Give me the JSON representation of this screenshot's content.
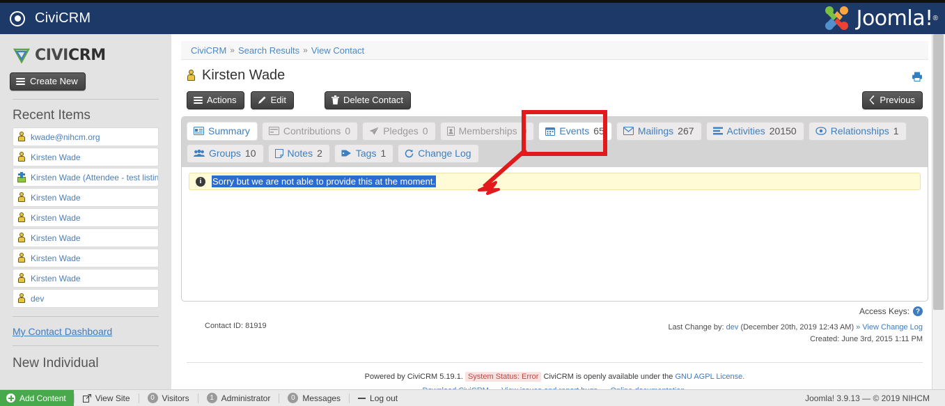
{
  "topbar": {
    "app_name": "CiviCRM",
    "logo_icon": "bullseye-icon",
    "brand_logo": "joomla-logo",
    "brand_name": "Joomla!",
    "brand_registered": "®"
  },
  "sidebar": {
    "logo_text_a": "CIVI",
    "logo_text_b": "CRM",
    "create_new_label": "Create New",
    "recent_items_title": "Recent Items",
    "recent_items": [
      {
        "label": "kwade@nihcm.org",
        "icon": "contact-icon"
      },
      {
        "label": "Kirsten Wade",
        "icon": "contact-icon"
      },
      {
        "label": "Kirsten Wade (Attendee - test listing)",
        "icon": "event-participant-icon"
      },
      {
        "label": "Kirsten Wade",
        "icon": "contact-icon"
      },
      {
        "label": "Kirsten Wade",
        "icon": "contact-icon"
      },
      {
        "label": "Kirsten Wade",
        "icon": "contact-icon"
      },
      {
        "label": "Kirsten Wade",
        "icon": "contact-icon"
      },
      {
        "label": "Kirsten Wade",
        "icon": "contact-icon"
      },
      {
        "label": "dev",
        "icon": "contact-icon"
      }
    ],
    "dashboard_link": "My Contact Dashboard",
    "new_individual_heading": "New Individual"
  },
  "breadcrumb": {
    "items": [
      "CiviCRM",
      "Search Results",
      "View Contact"
    ],
    "separator": "»"
  },
  "contact": {
    "name": "Kirsten Wade",
    "icon": "contact-lock-icon",
    "print_icon": "printer-icon"
  },
  "actions": {
    "actions_label": "Actions",
    "edit_label": "Edit",
    "delete_label": "Delete Contact",
    "previous_label": "Previous",
    "actions_icon": "hamburger-icon",
    "edit_icon": "pencil-icon",
    "delete_icon": "trash-icon",
    "previous_icon": "chevron-left-icon"
  },
  "tabs": [
    {
      "label": "Summary",
      "count": "",
      "icon": "id-card-icon",
      "state": "active"
    },
    {
      "label": "Contributions",
      "count": "0",
      "icon": "credit-card-icon",
      "state": "disabled"
    },
    {
      "label": "Pledges",
      "count": "0",
      "icon": "paper-plane-icon",
      "state": "disabled"
    },
    {
      "label": "Memberships",
      "count": "0",
      "icon": "id-badge-icon",
      "state": "disabled"
    },
    {
      "label": "Events",
      "count": "65",
      "icon": "calendar-icon",
      "state": "highlight"
    },
    {
      "label": "Mailings",
      "count": "267",
      "icon": "envelope-icon",
      "state": "normal"
    },
    {
      "label": "Activities",
      "count": "20150",
      "icon": "list-icon",
      "state": "normal"
    },
    {
      "label": "Relationships",
      "count": "1",
      "icon": "handshake-icon",
      "state": "normal"
    },
    {
      "label": "Groups",
      "count": "10",
      "icon": "users-icon",
      "state": "normal"
    },
    {
      "label": "Notes",
      "count": "2",
      "icon": "note-icon",
      "state": "normal"
    },
    {
      "label": "Tags",
      "count": "1",
      "icon": "tag-icon",
      "state": "normal"
    },
    {
      "label": "Change Log",
      "count": "",
      "icon": "history-icon",
      "state": "normal"
    }
  ],
  "message": {
    "icon": "info-icon",
    "icon_glyph": "i",
    "text": "Sorry but we are not able to provide this at the moment.",
    "selected": true
  },
  "access_keys": {
    "label": "Access Keys:",
    "help_icon": "question-mark-icon",
    "help_glyph": "?"
  },
  "meta": {
    "contact_id_label": "Contact ID: 81919",
    "last_change_prefix": "Last Change by:",
    "last_change_user": "dev",
    "last_change_date": "(December 20th, 2019 12:43 AM)",
    "view_change_log": "» View Change Log",
    "created": "Created: June 3rd, 2015 1:11 PM"
  },
  "footer": {
    "powered_prefix": "Powered by CiviCRM 5.19.1.",
    "system_status": "System Status: Error",
    "openly_text": "CiviCRM is openly available under the",
    "license_link": "GNU AGPL License.",
    "links": [
      "Download CiviCRM.",
      "View issues and report bugs.",
      "Online documentation."
    ]
  },
  "adminbar": {
    "add_content": "Add Content",
    "add_content_icon": "plus-circle-icon",
    "view_site": "View Site",
    "view_site_icon": "external-link-icon",
    "visitors_count": "0",
    "visitors_label": "Visitors",
    "admin_count": "1",
    "admin_label": "Administrator",
    "messages_count": "0",
    "messages_label": "Messages",
    "logout_label": "Log out",
    "logout_icon": "minus-icon",
    "right_text": "Joomla! 3.9.13  —  © 2019 NIHCM"
  },
  "annotation": {
    "highlight_color": "#e11b1b",
    "shape": "rectangle-around-events-tab",
    "arrow": "arrow-to-message"
  }
}
